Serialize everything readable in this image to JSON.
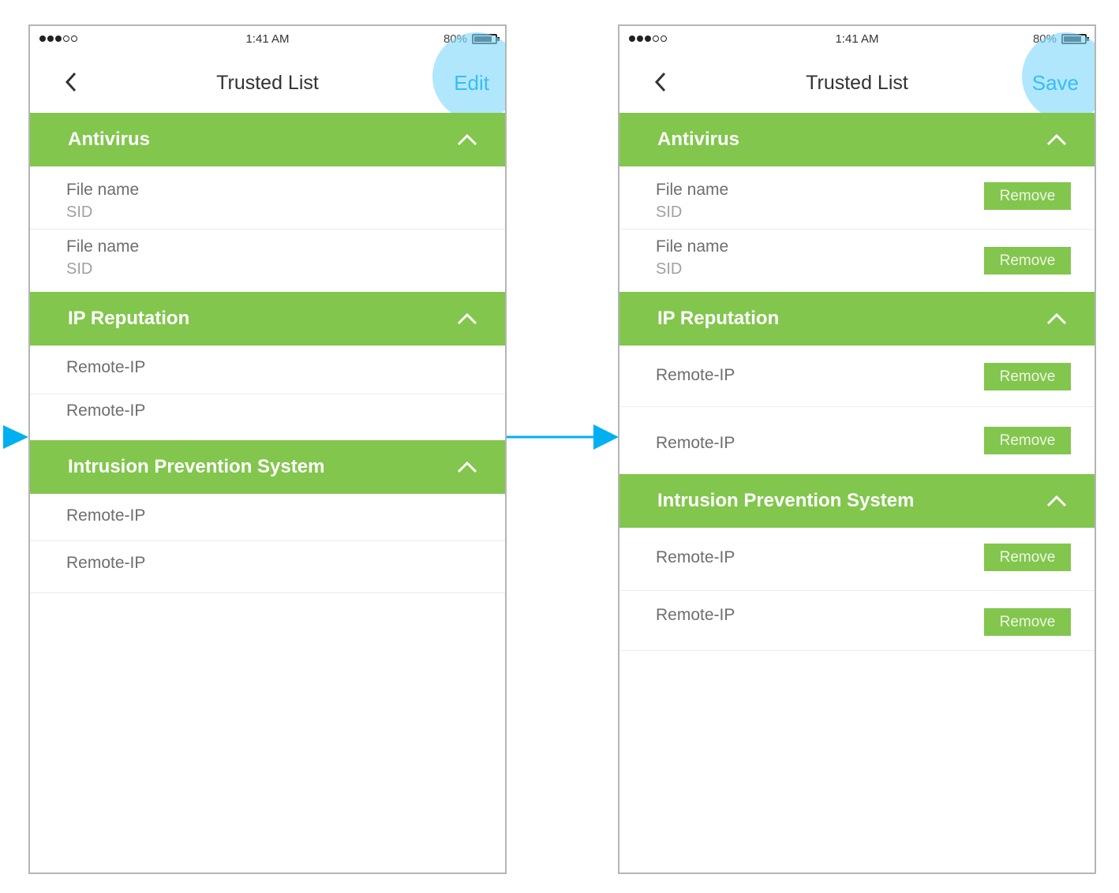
{
  "colors": {
    "accent": "#82c64d",
    "link": "#38bdf3",
    "arrow": "#00b0f0"
  },
  "left": {
    "status": {
      "time": "1:41 AM",
      "battery": "80%",
      "battery_level": 0.8
    },
    "nav": {
      "title": "Trusted List",
      "action": "Edit"
    },
    "sections": [
      {
        "title": "Antivirus",
        "rows": [
          {
            "primary": "File name",
            "secondary": "SID"
          },
          {
            "primary": "File name",
            "secondary": "SID"
          }
        ]
      },
      {
        "title": "IP Reputation",
        "rows": [
          {
            "primary": "Remote-IP"
          },
          {
            "primary": "Remote-IP"
          }
        ]
      },
      {
        "title": "Intrusion Prevention System",
        "rows": [
          {
            "primary": "Remote-IP"
          },
          {
            "primary": "Remote-IP"
          }
        ]
      }
    ]
  },
  "right": {
    "status": {
      "time": "1:41 AM",
      "battery": "80%",
      "battery_level": 0.8
    },
    "nav": {
      "title": "Trusted List",
      "action": "Save"
    },
    "remove_label": "Remove",
    "sections": [
      {
        "title": "Antivirus",
        "rows": [
          {
            "primary": "File name",
            "secondary": "SID"
          },
          {
            "primary": "File name",
            "secondary": "SID"
          }
        ]
      },
      {
        "title": "IP Reputation",
        "rows": [
          {
            "primary": "Remote-IP"
          },
          {
            "primary": "Remote-IP"
          }
        ]
      },
      {
        "title": "Intrusion Prevention System",
        "rows": [
          {
            "primary": "Remote-IP"
          },
          {
            "primary": "Remote-IP"
          }
        ]
      }
    ]
  }
}
